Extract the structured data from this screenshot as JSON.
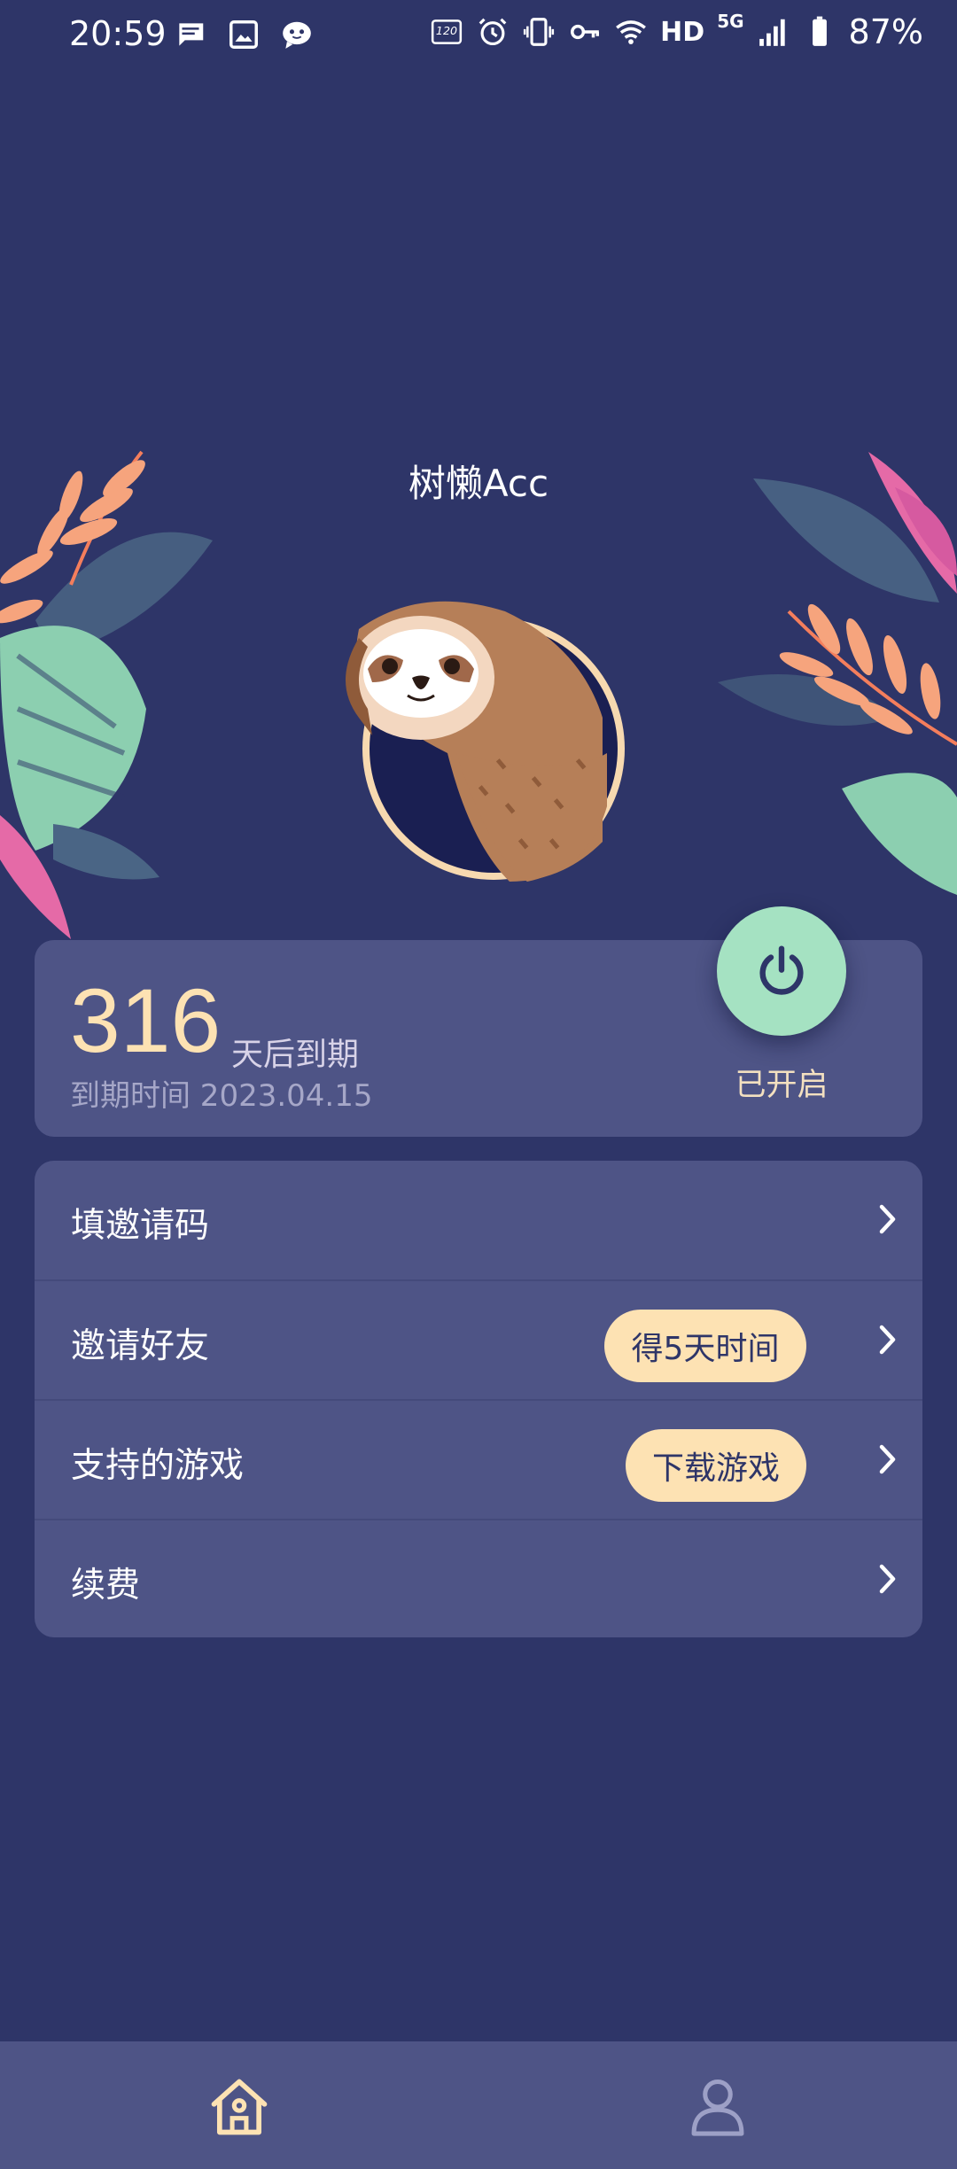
{
  "status_bar": {
    "time": "20:59",
    "left_icons": [
      "message-icon",
      "image-icon",
      "chat-bubble-icon"
    ],
    "right_icons": [
      "refresh-rate-120hz-icon",
      "alarm-icon",
      "vibrate-icon",
      "vpn-key-icon",
      "wifi-icon",
      "signal-icon",
      "battery-icon"
    ],
    "hd_label": "HD",
    "network_label": "5G",
    "battery_percent": "87%"
  },
  "header": {
    "app_title": "树懒Acc"
  },
  "expiry": {
    "days_remaining": "316",
    "days_suffix": "天后到期",
    "expire_label": "到期时间 2023.04.15"
  },
  "power": {
    "status_label": "已开启",
    "icon": "power-icon"
  },
  "menu": {
    "items": [
      {
        "label": "填邀请码",
        "badge": ""
      },
      {
        "label": "邀请好友",
        "badge": "得5天时间"
      },
      {
        "label": "支持的游戏",
        "badge": "下载游戏"
      },
      {
        "label": "续费",
        "badge": ""
      }
    ]
  },
  "bottom_nav": {
    "items": [
      {
        "icon": "home-icon",
        "active": true
      },
      {
        "icon": "profile-icon",
        "active": false
      }
    ]
  },
  "colors": {
    "background": "#2e3568",
    "card": "#4e5486",
    "accent_cream": "#fde2b3",
    "power_green": "#a5e2c2"
  }
}
